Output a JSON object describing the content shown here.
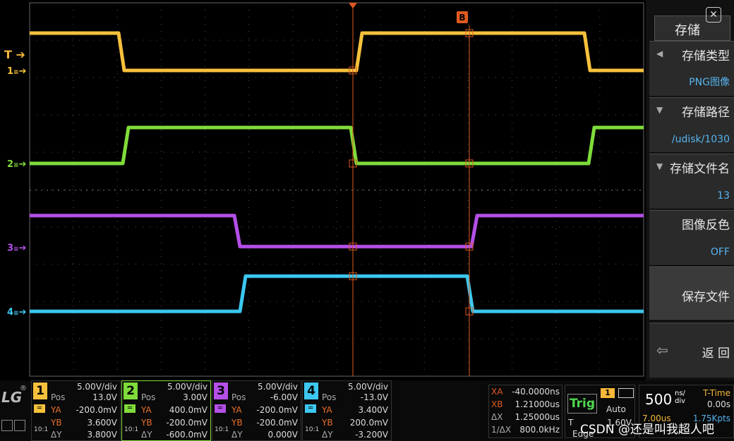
{
  "menu": {
    "title": "存储",
    "items": [
      {
        "label": "存储类型",
        "value": "PNG图像"
      },
      {
        "label": "存储路径",
        "value": "/udisk/1030"
      },
      {
        "label": "存储文件名",
        "value": "13"
      },
      {
        "label": "图像反色",
        "value": "OFF"
      },
      {
        "label": "保存文件",
        "value": ""
      },
      {
        "label": "返 回",
        "value": ""
      }
    ]
  },
  "markers": {
    "trigger": "T",
    "cursor_b": "B",
    "ch1": "1",
    "ch2": "2",
    "ch3": "3",
    "ch4": "4"
  },
  "colors": {
    "ch1": "#f7c13c",
    "ch2": "#7fdc3a",
    "ch3": "#b44fe8",
    "ch4": "#3cc8f0",
    "cursor": "#e05a20",
    "grid": "#555555"
  },
  "channels": [
    {
      "num": "1",
      "scale": "5.00V/div",
      "pos_label": "Pos",
      "pos": "13.0V",
      "ya_label": "YA",
      "ya": "-200.0mV",
      "yb_label": "YB",
      "yb": "3.600V",
      "dy_label": "ΔY",
      "dy": "3.800V",
      "ratio": "10:1"
    },
    {
      "num": "2",
      "scale": "5.00V/div",
      "pos_label": "Pos",
      "pos": "3.00V",
      "ya_label": "YA",
      "ya": "400.0mV",
      "yb_label": "YB",
      "yb": "-200.0mV",
      "dy_label": "ΔY",
      "dy": "-600.0mV",
      "ratio": "10:1"
    },
    {
      "num": "3",
      "scale": "5.00V/div",
      "pos_label": "Pos",
      "pos": "-6.00V",
      "ya_label": "YA",
      "ya": "-200.0mV",
      "yb_label": "YB",
      "yb": "-200.0mV",
      "dy_label": "ΔY",
      "dy": "0.000V",
      "ratio": "10:1"
    },
    {
      "num": "4",
      "scale": "5.00V/div",
      "pos_label": "Pos",
      "pos": "-13.0V",
      "ya_label": "YA",
      "ya": "3.400V",
      "yb_label": "YB",
      "yb": "200.0mV",
      "dy_label": "ΔY",
      "dy": "-3.200V",
      "ratio": "10:1"
    }
  ],
  "cursors": {
    "xa_label": "XA",
    "xa": "-40.0000ns",
    "xb_label": "XB",
    "xb": "1.21000us",
    "dx_label": "ΔX",
    "dx": "1.25000us",
    "inv_label": "1/ΔX",
    "inv": "800.0kHz"
  },
  "trigger": {
    "label": "Trig",
    "source": "1",
    "mode": "Auto",
    "t_label": "T",
    "level": "1.60V",
    "type": "Edge"
  },
  "timebase": {
    "value": "500",
    "unit_top": "ns/",
    "unit_bottom": "div",
    "ttime_label": "T-Time",
    "ttime": "0.00s",
    "sample_rate": "7.00us",
    "memory": "1.75Kpts"
  },
  "watermark": "CSDN @还是叫我超人吧",
  "brand": "LG"
}
